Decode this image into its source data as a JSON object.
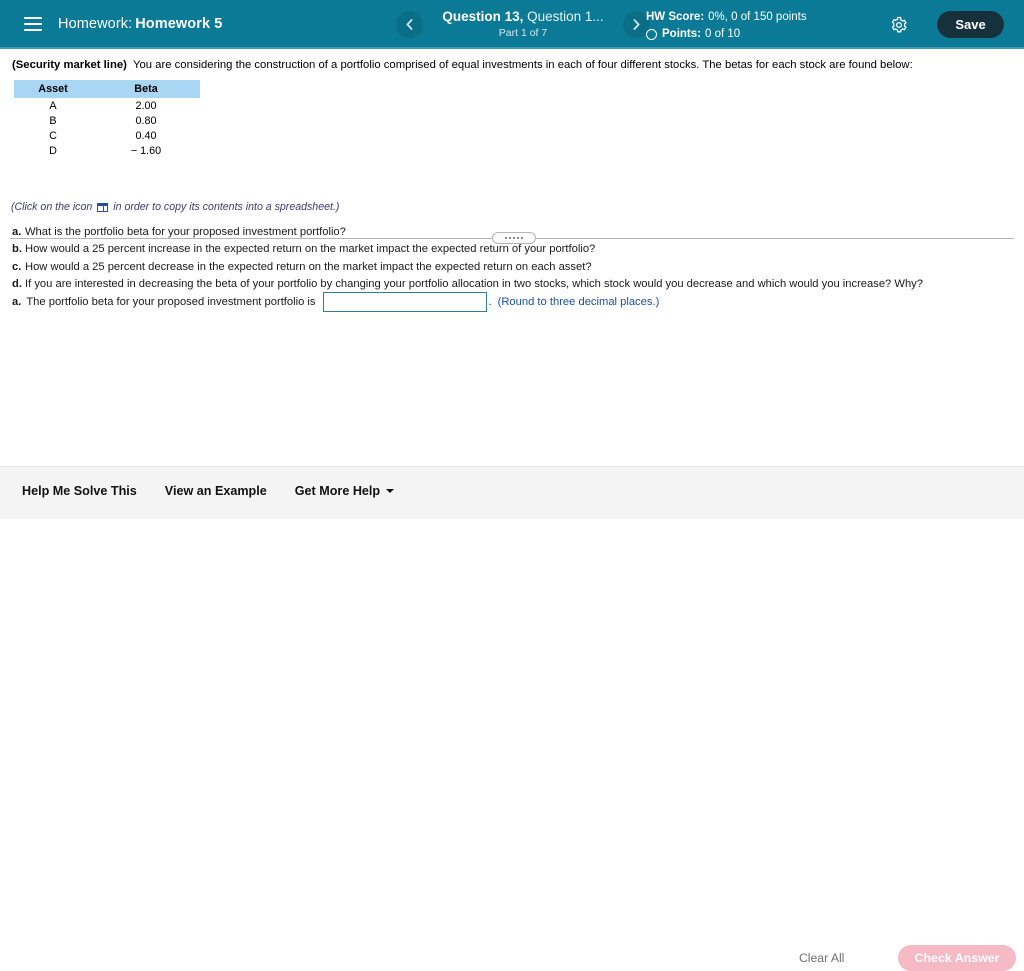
{
  "header": {
    "menu_icon": "hamburger-icon",
    "course_label": "Homework:",
    "assignment_name": "Homework 5",
    "prev_icon": "chevron-left-icon",
    "next_icon": "chevron-right-icon",
    "question_main": "Question 13,",
    "question_sub": "Question 1...",
    "part_label": "Part 1 of 7",
    "hw_score_label": "HW Score:",
    "hw_score_value": "0%, 0 of 150 points",
    "points_label": "Points:",
    "points_value": "0 of 10",
    "points_icon": "circle-outline-icon",
    "settings_icon": "gear-icon",
    "save_label": "Save",
    "bg_color": "#0b7a96",
    "save_bg_color": "#17313c"
  },
  "question": {
    "topic": "(Security market line)",
    "prompt": "You are considering the construction of a portfolio comprised of equal investments in each of four different stocks.  The betas for each stock are found below:",
    "table": {
      "headers": [
        "Asset",
        "Beta"
      ],
      "rows": [
        [
          "A",
          "2.00"
        ],
        [
          "B",
          "0.80"
        ],
        [
          "C",
          "0.40"
        ],
        [
          "D",
          "− 1.60"
        ]
      ],
      "header_bg_color": "#a9d6f2"
    },
    "copy_note_before": "(Click on the icon",
    "copy_note_icon": "spreadsheet-icon",
    "copy_note_after": "in order to copy its contents into a spreadsheet.)",
    "parts": [
      {
        "letter": "a.",
        "text": "What is the portfolio beta for your proposed investment portfolio?"
      },
      {
        "letter": "b.",
        "text": "How would a 25 percent increase in the expected return on the market impact the expected return of your portfolio?"
      },
      {
        "letter": "c.",
        "text": "How would a 25 percent decrease in the expected return on the market impact the expected return on each asset?"
      },
      {
        "letter": "d.",
        "text": "If you are interested in decreasing the beta of your portfolio by changing your portfolio allocation in two stocks, which stock would you decrease and which would you increase?  Why?"
      }
    ]
  },
  "answer": {
    "letter": "a.",
    "label": "The portfolio beta for your proposed investment portfolio is",
    "input_value": "",
    "period": ".",
    "hint": "(Round to three decimal places.)",
    "hint_color": "#1a4fa0",
    "input_border_color": "#2d7f9d"
  },
  "footer": {
    "links": [
      {
        "label": "Help Me Solve This",
        "has_caret": false
      },
      {
        "label": "View an Example",
        "has_caret": false
      },
      {
        "label": "Get More Help",
        "has_caret": true
      }
    ],
    "clear_all_label": "Clear All",
    "check_answer_label": "Check Answer",
    "check_answer_bg_color": "#f6b9c6"
  }
}
